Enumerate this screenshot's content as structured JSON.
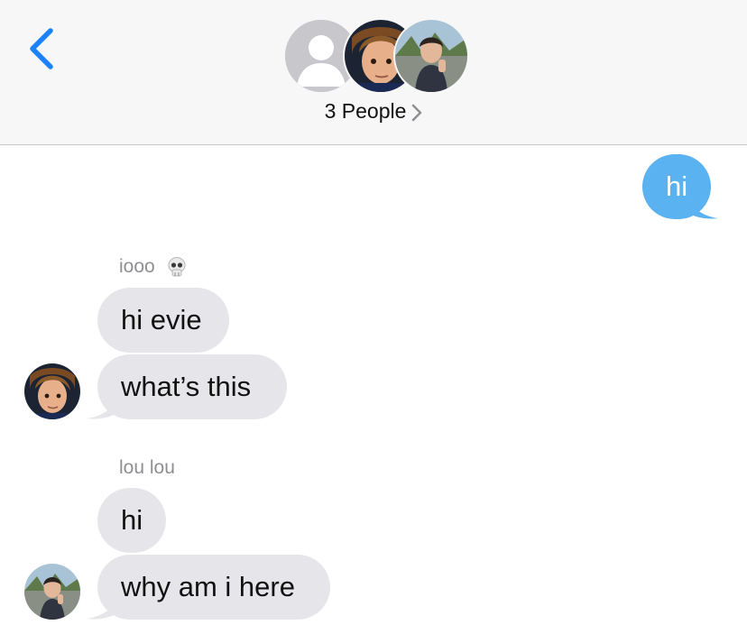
{
  "header": {
    "back_icon": "chevron-left-icon",
    "participants_label": "3 People",
    "participants_chevron": "chevron-right-icon",
    "avatars": [
      {
        "name": "default-contact-avatar",
        "icon": "person-silhouette-icon"
      },
      {
        "name": "contact-photo-avatar-1"
      },
      {
        "name": "contact-photo-avatar-2"
      }
    ]
  },
  "messages": {
    "outgoing_1": "hi",
    "group_1": {
      "sender": "iooo",
      "sender_emoji": "skull-emoji",
      "bubble_1": "hi evie",
      "bubble_2": "what’s this"
    },
    "group_2": {
      "sender": "lou lou",
      "bubble_1": "hi",
      "bubble_2": "why am i here"
    }
  },
  "colors": {
    "accent_blue": "#1a82fb",
    "outgoing_bubble": "#5ab2f0",
    "incoming_bubble": "#e6e5ea",
    "header_bg": "#f7f7f7",
    "sender_gray": "#8e8e93"
  }
}
